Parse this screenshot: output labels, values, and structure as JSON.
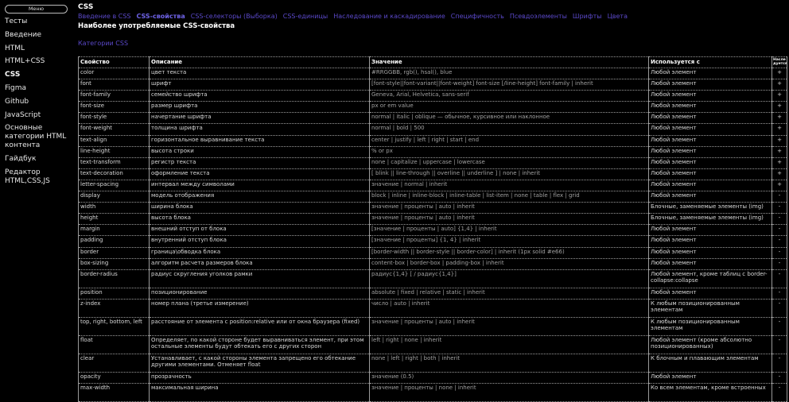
{
  "sidebar": {
    "menu_label": "Меню",
    "items": [
      {
        "label": "Тесты"
      },
      {
        "label": "Введение"
      },
      {
        "label": "HTML"
      },
      {
        "label": "HTML+CSS"
      },
      {
        "label": "CSS",
        "active": true
      },
      {
        "label": "Figma"
      },
      {
        "label": "Github"
      },
      {
        "label": "JavaScript"
      },
      {
        "label": "Основные категории HTML контента"
      },
      {
        "label": "Гайдбук"
      },
      {
        "label": "Редактор HTML,CSS,JS"
      }
    ]
  },
  "main": {
    "heading": "CSS",
    "tabs": [
      {
        "label": "Введение в CSS"
      },
      {
        "label": "CSS-свойства",
        "current": true
      },
      {
        "label": "CSS-селекторы (Выборка)"
      },
      {
        "label": "CSS-единицы"
      },
      {
        "label": "Наследование и каскадирование"
      },
      {
        "label": "Специфичность"
      },
      {
        "label": "Псевдоэлементы"
      },
      {
        "label": "Шрифты"
      },
      {
        "label": "Цвета"
      }
    ],
    "section_title": "Наиболее употребляемые CSS-свойства",
    "categories_link": "Категории CSS",
    "table": {
      "headers": [
        "Свойство",
        "Описание",
        "Значение",
        "Используется с",
        "Насле дуется"
      ],
      "rows": [
        [
          "color",
          "цвет текста",
          "#RRGGBB, rgb(), hsal(), blue",
          "Любой элемент",
          "+"
        ],
        [
          "font",
          "шрифт",
          "[font-style||font-variant||font-weight] font-size [/line-height] font-family | inherit",
          "Любой элемент",
          "+"
        ],
        [
          "font-family",
          "семейство шрифта",
          "Geneva, Arial, Helvetica, sans-serif",
          "Любой элемент",
          "+"
        ],
        [
          "font-size",
          "размер шрифта",
          "px or em value",
          "Любой элемент",
          "+"
        ],
        [
          "font-style",
          "начертание шрифта",
          "normal | italic | oblique — обычное, курсивное или наклонное",
          "Любой элемент",
          "+"
        ],
        [
          "font-weight",
          "толщина шрифта",
          "normal | bold | 500",
          "Любой элемент",
          "+"
        ],
        [
          "text-align",
          "горизонтальное выравнивание текста",
          "center | justify | left | right | start | end",
          "Любой элемент",
          "+"
        ],
        [
          "line-height",
          "высота строки",
          "% or px",
          "Любой элемент",
          "+"
        ],
        [
          "text-transform",
          "регистр текста",
          "none | capitalize | uppercase | lowercase",
          "Любой элемент",
          "+"
        ],
        [
          "text-decoration",
          "оформление текста",
          "[ blink || line-through || overline || underline ] | none | inherit",
          "Любой элемент",
          "+"
        ],
        [
          "letter-spacing",
          "интервал между символами",
          "значение | normal | inherit",
          "Любой элемент",
          "+"
        ],
        [
          "display",
          "модель отображения",
          "block | inline | inline-block | inline-table | list-item | none | table | flex | grid",
          "Любой элемент",
          "-"
        ],
        [
          "width",
          "ширина блока",
          "значение | проценты | auto | inherit",
          "Блочные, заменяемые элементы (img)",
          "-"
        ],
        [
          "height",
          "высота блока",
          "значение | проценты | auto | inherit",
          "Блочные, заменяемые элементы (img)",
          "-"
        ],
        [
          "margin",
          "внешний отступ от блока",
          "[значение | проценты | auto] {1,4} | inherit",
          "Любой элемент",
          "-"
        ],
        [
          "padding",
          "внутренний отступ блока",
          "[значение | проценты] {1, 4} | inherit",
          "Любой элемент",
          "-"
        ],
        [
          "border",
          "граница\\обводка блока",
          "[border-width || border-style || border-color] | inherit (1px solid #e66)",
          "Любой элемент",
          "-"
        ],
        [
          "box-sizing",
          "алгоритм расчета размеров блока",
          "content-box | border-box | padding-box | inherit",
          "Любой элемент",
          "-"
        ],
        [
          "border-radius",
          "радиус скругления уголков рамки",
          "радиус{1,4} [ / радиус{1,4}]",
          "Любой элемент, кроме таблиц с border-collapse:collapse",
          "-"
        ],
        [
          "position",
          "позиционирование",
          "absolute | fixed | relative | static | inherit",
          "Любой элемент",
          "-"
        ],
        [
          "z-index",
          "номер плана (третье измерение)",
          "число | auto | inherit",
          "К любым позиционированным элементам",
          "-"
        ],
        [
          "top, right, bottom, left",
          "расстояние от элемента с position:relative или от окна браузера (fixed)",
          "значение | проценты | auto | inherit",
          "К любым позиционированным элементам",
          "-"
        ],
        [
          "float",
          "Определяет, по какой стороне будет выравниваться элемент, при этом остальные элементы будут обтекать его с других сторон",
          "left | right | none | inherit",
          "Любой элемент (кроме абсолютно позиционированных)",
          "-"
        ],
        [
          "clear",
          "Устанавливает, с какой стороны элемента запрещено его обтекание другими элементами. Отменяет float",
          "none | left | right | both | inherit",
          "К блочным и плавающим элементам",
          "-"
        ],
        [
          "opacity",
          "прозрачность",
          "значение (0.5)",
          "Любой элемент",
          "-"
        ],
        [
          "max-width",
          "максимальная ширина",
          "значение | проценты | none | inherit",
          "Ко всем элементам, кроме встроенных",
          "-"
        ]
      ]
    }
  }
}
